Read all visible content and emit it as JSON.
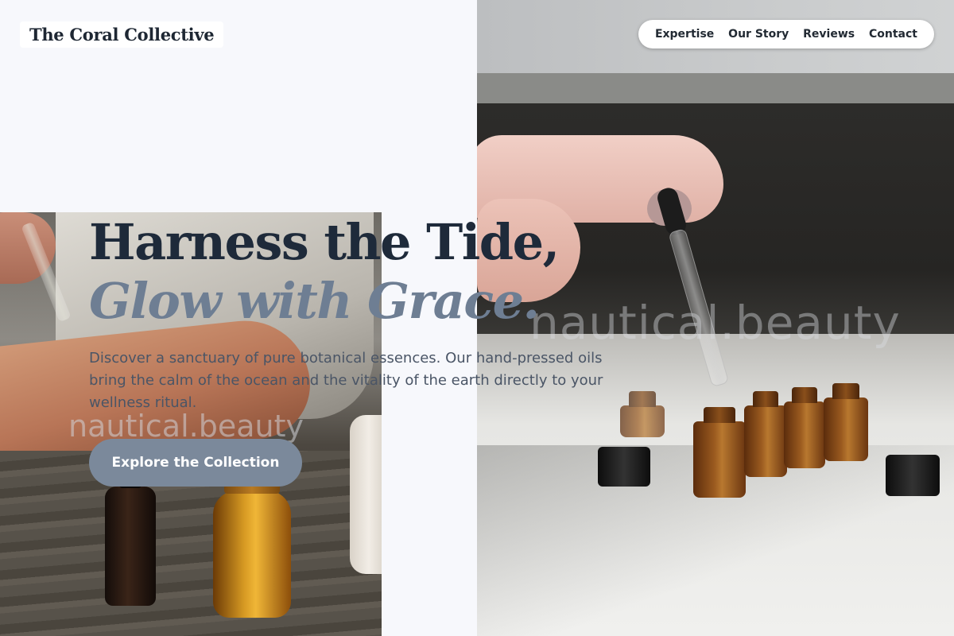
{
  "brand": {
    "name": "The Coral Collective"
  },
  "nav": {
    "items": [
      {
        "label": "Expertise"
      },
      {
        "label": "Our Story"
      },
      {
        "label": "Reviews"
      },
      {
        "label": "Contact"
      }
    ]
  },
  "hero": {
    "headline_line1": "Harness the Tide,",
    "headline_line2": "Glow with Grace.",
    "lead": "Discover a sanctuary of pure botanical essences. Our hand-pressed oils bring the calm of the ocean and the vitality of the earth directly to your wellness ritual.",
    "cta_label": "Explore the Collection"
  },
  "watermarks": {
    "primary": "nautical.beauty",
    "secondary": "nautical.beauty"
  },
  "colors": {
    "background": "#f7f8fc",
    "headline": "#1e2a3a",
    "headline_accent": "#6e7e93",
    "body_text": "#4a5566",
    "button": "#7b899b"
  }
}
